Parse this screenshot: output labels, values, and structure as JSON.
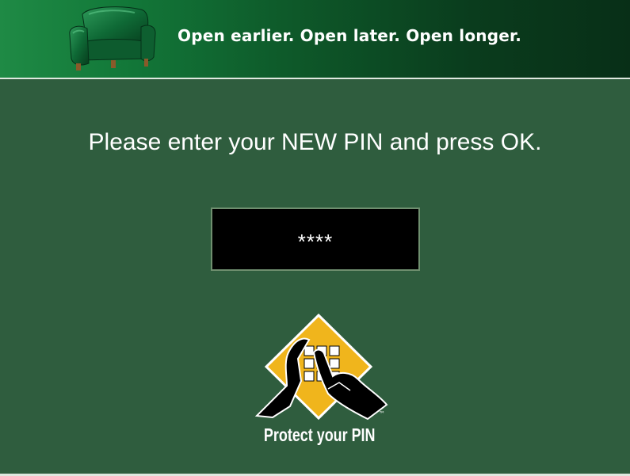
{
  "banner": {
    "tagline": "Open earlier. Open later. Open longer.",
    "image_icon": "armchair-icon"
  },
  "screen": {
    "prompt": "Please enter your NEW PIN and press OK.",
    "pin_value": "****"
  },
  "logo": {
    "icon": "protect-pin-icon",
    "text": "Protect your PIN",
    "trademark": "™"
  },
  "colors": {
    "background": "#2f5d3e",
    "banner_start": "#1f8a45",
    "banner_end": "#082f17",
    "logo_yellow": "#f0b51c",
    "field_background": "#000000"
  }
}
